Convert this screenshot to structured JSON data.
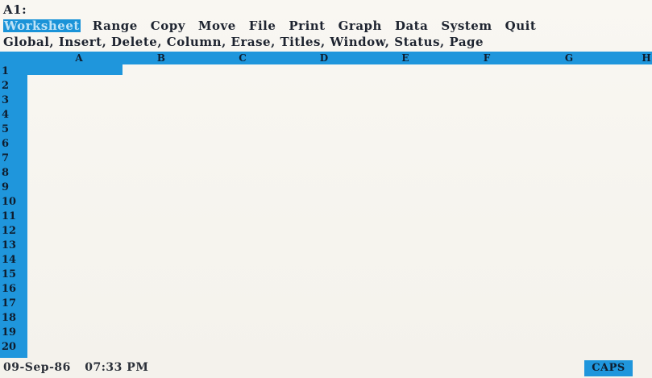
{
  "cell_reference": "A1:",
  "menu": {
    "items": [
      {
        "label": "Worksheet",
        "selected": true
      },
      {
        "label": "Range",
        "selected": false
      },
      {
        "label": "Copy",
        "selected": false
      },
      {
        "label": "Move",
        "selected": false
      },
      {
        "label": "File",
        "selected": false
      },
      {
        "label": "Print",
        "selected": false
      },
      {
        "label": "Graph",
        "selected": false
      },
      {
        "label": "Data",
        "selected": false
      },
      {
        "label": "System",
        "selected": false
      },
      {
        "label": "Quit",
        "selected": false
      }
    ]
  },
  "submenu_prompt": "Global, Insert, Delete, Column, Erase, Titles, Window, Status, Page",
  "columns": [
    "A",
    "B",
    "C",
    "D",
    "E",
    "F",
    "G",
    "H"
  ],
  "rows": [
    "1",
    "2",
    "3",
    "4",
    "5",
    "6",
    "7",
    "8",
    "9",
    "10",
    "11",
    "12",
    "13",
    "14",
    "15",
    "16",
    "17",
    "18",
    "19",
    "20"
  ],
  "status": {
    "date": "09-Sep-86",
    "time": "07:33 PM",
    "caps_indicator": "CAPS"
  },
  "colors": {
    "accent": "#1f96dc",
    "background": "#f7f5ef",
    "text": "#1e2430"
  }
}
